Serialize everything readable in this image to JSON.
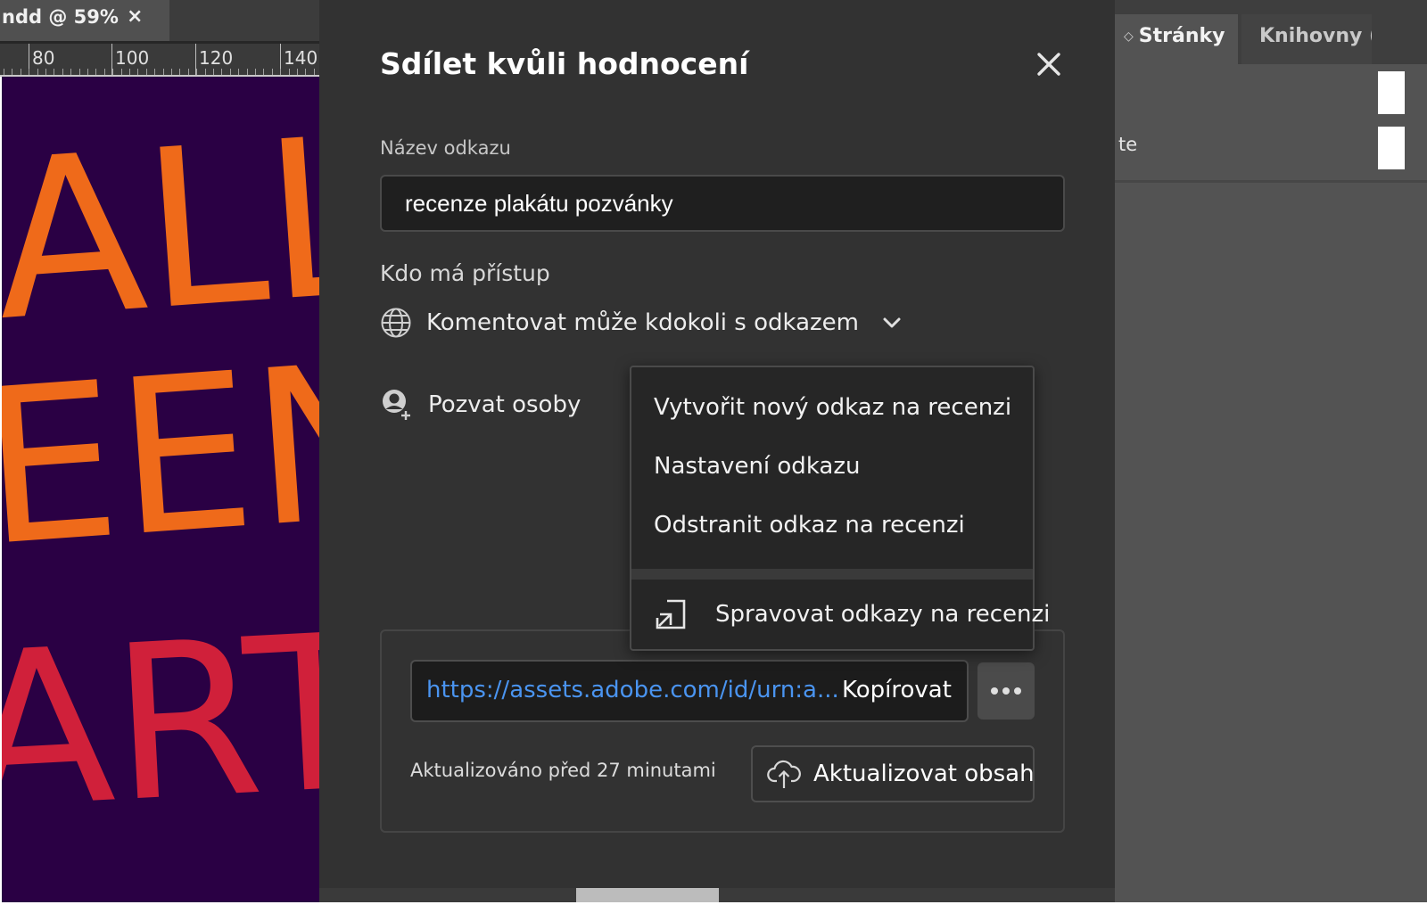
{
  "document": {
    "tab_title": "ndd @ 59%",
    "tab_close": "×",
    "ruler_labels": [
      "80",
      "100",
      "120",
      "140"
    ],
    "canvas_text_lines": [
      "ALLO",
      "EEN",
      "ARTY"
    ],
    "colors": {
      "canvas_bg": "#2a0044",
      "text_orange": "#ef6a1a",
      "text_red": "#d0203a"
    }
  },
  "right_panel": {
    "active_tab": "Stránky",
    "inactive_tab": "Knihovny (",
    "partial_text": "te"
  },
  "dialog": {
    "title": "Sdílet kvůli hodnocení",
    "close_icon": "close-icon",
    "link_name_label": "Název odkazu",
    "link_name_value": "recenze plakátu pozvánky",
    "access_label": "Kdo má přístup",
    "access_value": "Komentovat může kdokoli s odkazem",
    "invite_label": "Pozvat osoby",
    "url": "https://assets.adobe.com/id/urn:a...",
    "copy_label": "Kopírovat",
    "updated_text": "Aktualizováno před 27 minutami",
    "update_button": "Aktualizovat obsah",
    "link_color": "#4a94f0"
  },
  "menu": {
    "items": [
      "Vytvořit nový odkaz na recenzi",
      "Nastavení odkazu",
      "Odstranit odkaz na recenzi"
    ],
    "footer_item": "Spravovat odkazy na recenzi"
  }
}
